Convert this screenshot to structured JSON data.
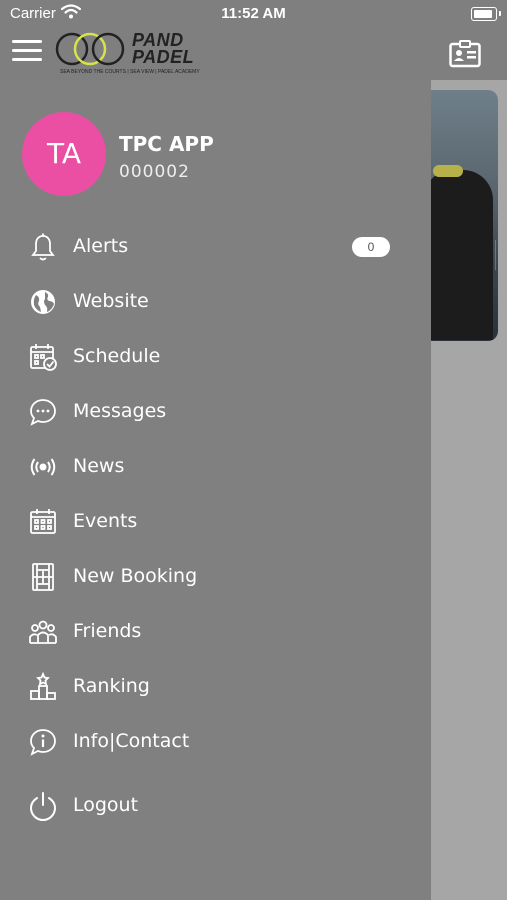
{
  "status_bar": {
    "carrier": "Carrier",
    "time": "11:52 AM"
  },
  "header": {
    "logo_line1": "PAND",
    "logo_line2": "PADEL",
    "logo_tagline": "SEA BEYOND THE COURTS | SEA VIEW | PADEL ACADEMY"
  },
  "profile": {
    "initials": "TA",
    "name": "TPC APP",
    "member_id": "000002",
    "avatar_color": "#ea4fa4"
  },
  "menu": {
    "items": [
      {
        "label": "Alerts",
        "icon": "bell-icon",
        "badge": "0"
      },
      {
        "label": "Website",
        "icon": "globe-icon"
      },
      {
        "label": "Schedule",
        "icon": "calendar-check-icon"
      },
      {
        "label": "Messages",
        "icon": "chat-bubble-icon"
      },
      {
        "label": "News",
        "icon": "broadcast-icon"
      },
      {
        "label": "Events",
        "icon": "calendar-grid-icon"
      },
      {
        "label": "New Booking",
        "icon": "court-icon"
      },
      {
        "label": "Friends",
        "icon": "people-icon"
      },
      {
        "label": "Ranking",
        "icon": "podium-icon"
      },
      {
        "label": "Info|Contact",
        "icon": "info-bubble-icon"
      },
      {
        "label": "Logout",
        "icon": "power-icon"
      }
    ]
  },
  "colors": {
    "drawer_bg": "#808080",
    "header_bg": "#7f7f7f",
    "backdrop": "#a6a6a6",
    "text": "#ffffff"
  }
}
